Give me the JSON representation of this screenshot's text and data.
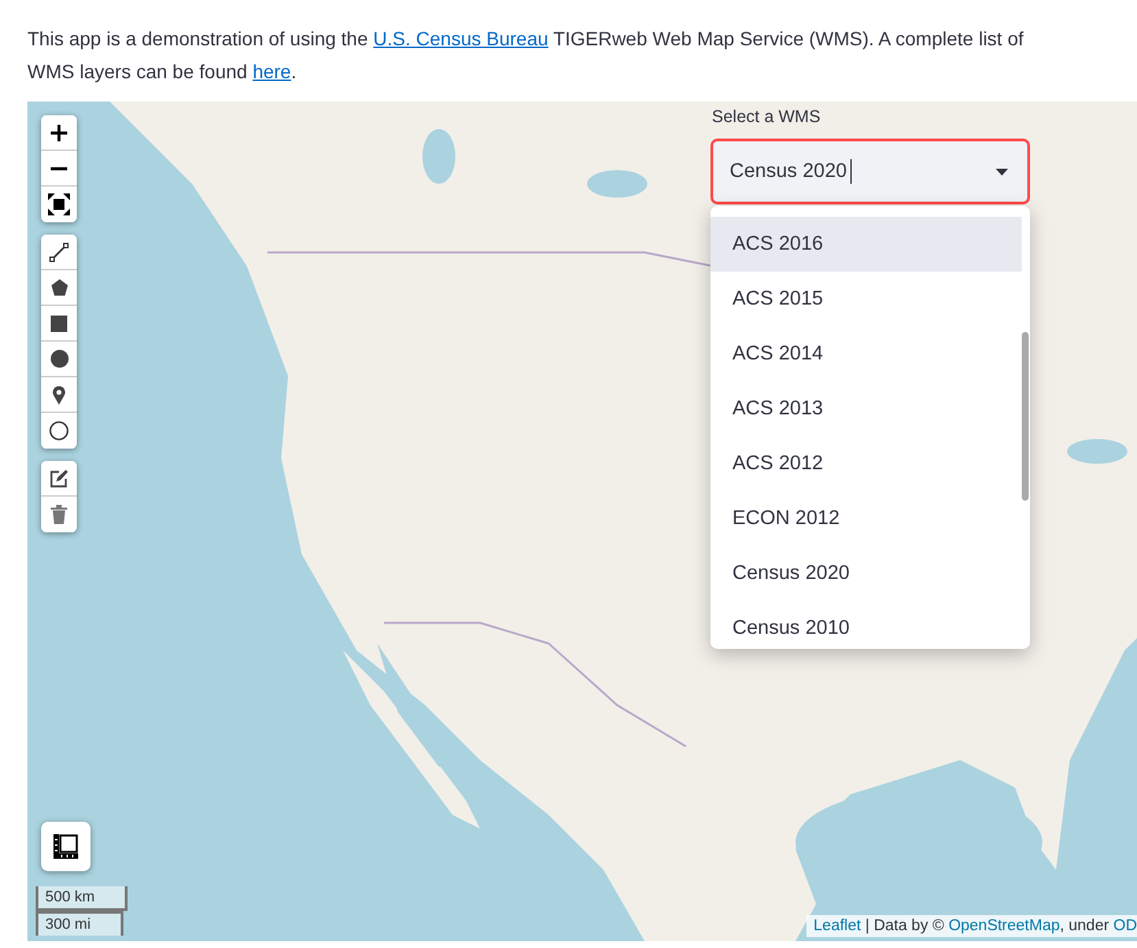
{
  "intro": [
    {
      "kind": "text",
      "text": "This app is a demonstration of using the "
    },
    {
      "kind": "link",
      "text": "U.S. Census Bureau"
    },
    {
      "kind": "text",
      "text": " TIGERweb Web Map Service (WMS). A complete list of WMS layers can be found "
    },
    {
      "kind": "link",
      "text": "here"
    },
    {
      "kind": "text",
      "text": "."
    }
  ],
  "wms_select": {
    "label": "Select a WMS",
    "value": "Census 2020",
    "focused": true,
    "options": [
      {
        "label": "ACS 2016",
        "highlighted": true
      },
      {
        "label": "ACS 2015",
        "highlighted": false
      },
      {
        "label": "ACS 2014",
        "highlighted": false
      },
      {
        "label": "ACS 2013",
        "highlighted": false
      },
      {
        "label": "ACS 2012",
        "highlighted": false
      },
      {
        "label": "ECON 2012",
        "highlighted": false
      },
      {
        "label": "Census 2020",
        "highlighted": false
      },
      {
        "label": "Census 2010",
        "highlighted": false
      }
    ]
  },
  "scale": [
    "500 km",
    "300 mi"
  ],
  "attribution": [
    {
      "kind": "link",
      "text": "Leaflet"
    },
    {
      "kind": "text",
      "text": " | Data by © "
    },
    {
      "kind": "link",
      "text": "OpenStreetMap"
    },
    {
      "kind": "text",
      "text": ", under "
    },
    {
      "kind": "link",
      "text": "OD"
    }
  ]
}
